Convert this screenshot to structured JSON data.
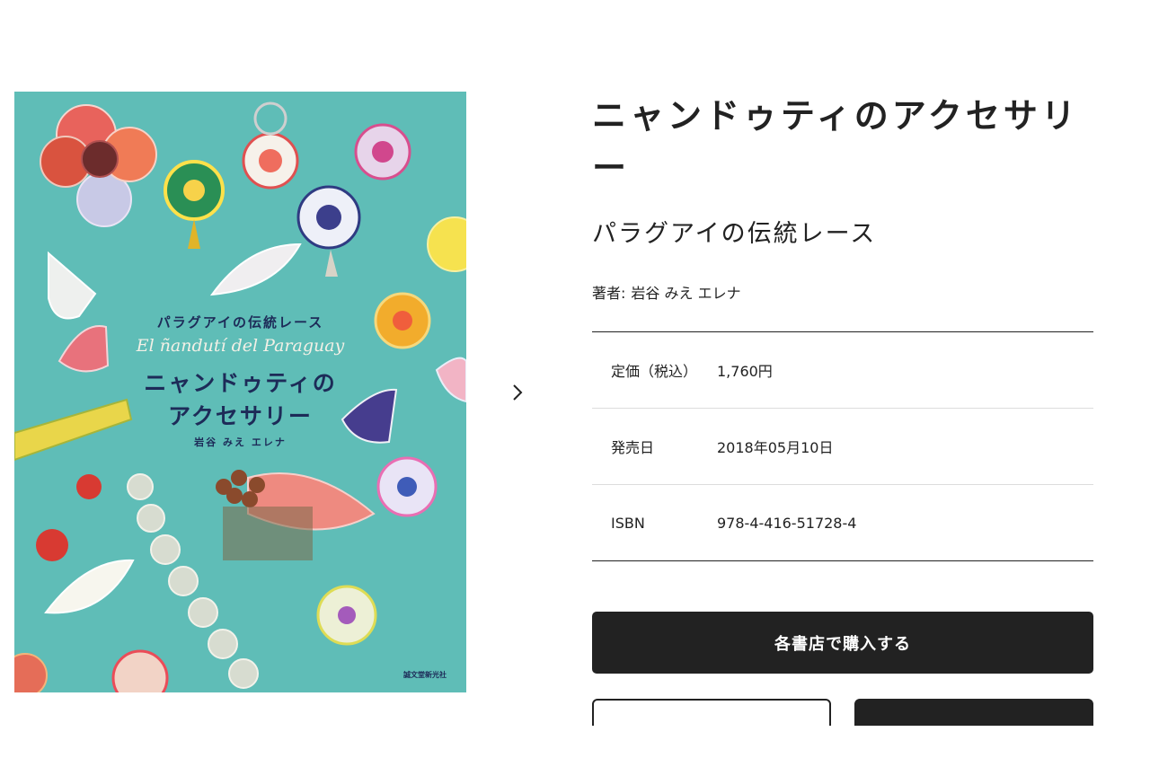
{
  "cover": {
    "subtitle": "パラグアイの伝統レース",
    "script_title": "El ñandutí del Paraguay",
    "title": "ニャンドゥティの\nアクセサリー",
    "author": "岩谷 みえ エレナ",
    "publisher": "誠文堂新光社",
    "background_color": "#5fbdb7"
  },
  "carousel": {
    "next_icon": "chevron-right-icon"
  },
  "book": {
    "title": "ニャンドゥティのアクセサリー",
    "subtitle": "パラグアイの伝統レース",
    "author_label": "著者:",
    "author": "岩谷 みえ エレナ"
  },
  "specs": [
    {
      "label": "定価（税込）",
      "value": "1,760円"
    },
    {
      "label": "発売日",
      "value": "2018年05月10日"
    },
    {
      "label": "ISBN",
      "value": "978-4-416-51728-4"
    }
  ],
  "actions": {
    "buy_label": "各書店で購入する",
    "buy_color": "#222222"
  }
}
